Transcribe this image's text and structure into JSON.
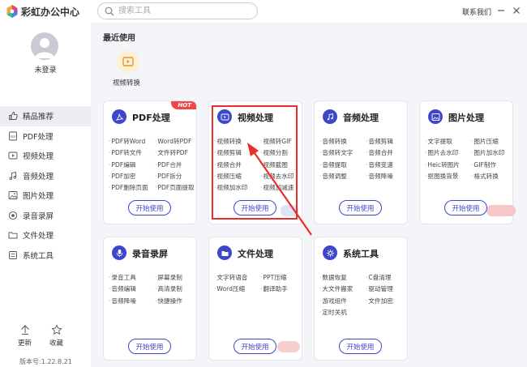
{
  "app": {
    "title": "彩虹办公中心"
  },
  "search": {
    "placeholder": "搜索工具"
  },
  "header": {
    "contact": "联系我们"
  },
  "user": {
    "status": "未登录"
  },
  "sidebar": {
    "items": [
      {
        "label": "精品推荐",
        "icon": "thumbs-up-icon",
        "active": true
      },
      {
        "label": "PDF处理",
        "icon": "pdf-icon"
      },
      {
        "label": "视频处理",
        "icon": "video-icon"
      },
      {
        "label": "音频处理",
        "icon": "music-icon"
      },
      {
        "label": "图片处理",
        "icon": "image-icon"
      },
      {
        "label": "录音录屏",
        "icon": "record-icon"
      },
      {
        "label": "文件处理",
        "icon": "folder-icon"
      },
      {
        "label": "系统工具",
        "icon": "tools-icon"
      }
    ],
    "update_label": "更新",
    "favorite_label": "收藏",
    "version": "版本号:1.22.8.21"
  },
  "recent": {
    "title": "最近使用",
    "items": [
      {
        "label": "视频转换"
      }
    ]
  },
  "cards": [
    {
      "title": "PDF处理",
      "badge": "HOT",
      "items": [
        "PDF转Word",
        "Word转PDF",
        "PDF转文件",
        "文件转PDF",
        "PDF编辑",
        "PDF合并",
        "PDF加密",
        "PDF拆分",
        "PDF删除页面",
        "PDF页面提取"
      ],
      "button": "开始使用"
    },
    {
      "title": "视频处理",
      "items": [
        "视频转换",
        "视频转GIF",
        "视频剪辑",
        "视频分割",
        "视频合并",
        "视频截图",
        "视频压缩",
        "视频去水印",
        "视频加水印",
        "视频加减速"
      ],
      "button": "开始使用"
    },
    {
      "title": "音频处理",
      "items": [
        "音频转换",
        "音频剪辑",
        "音频转文字",
        "音频合并",
        "音频提取",
        "音频变速",
        "音频调整",
        "音频降噪"
      ],
      "button": "开始使用"
    },
    {
      "title": "图片处理",
      "items": [
        "文字提取",
        "图片压缩",
        "图片去水印",
        "图片加水印",
        "Heic转图片",
        "GIF制作",
        "抠图换背景",
        "格式转换"
      ],
      "button": "开始使用"
    },
    {
      "title": "录音录屏",
      "items": [
        "录音工具",
        "屏幕录制",
        "音频编辑",
        "高清录制",
        "音频降噪",
        "快捷操作"
      ],
      "button": "开始使用"
    },
    {
      "title": "文件处理",
      "items": [
        "文字转语音",
        "PPT压缩",
        "Word压缩",
        "翻译助手"
      ],
      "button": "开始使用"
    },
    {
      "title": "系统工具",
      "items": [
        "数据恢复",
        "C盘清理",
        "大文件搬家",
        "驱动管理",
        "游戏组件",
        "文件加密",
        "定时关机"
      ],
      "button": "开始使用"
    }
  ],
  "colors": {
    "accent": "#3e47c8",
    "hot": "#f04848",
    "annotation": "#e8302a"
  }
}
